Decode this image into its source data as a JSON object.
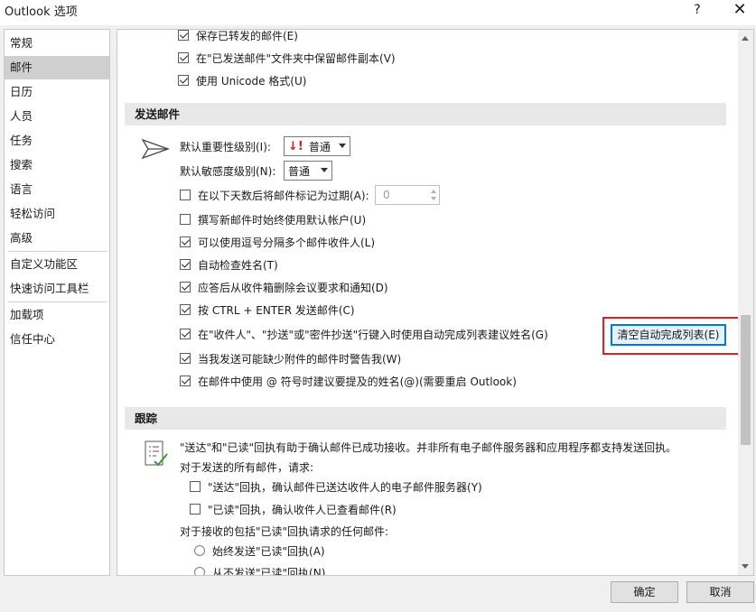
{
  "window": {
    "title": "Outlook 选项",
    "help": "?",
    "close": "✕"
  },
  "sidebar": {
    "items": [
      {
        "label": "常规"
      },
      {
        "label": "邮件"
      },
      {
        "label": "日历"
      },
      {
        "label": "人员"
      },
      {
        "label": "任务"
      },
      {
        "label": "搜索"
      },
      {
        "label": "语言"
      },
      {
        "label": "轻松访问"
      },
      {
        "label": "高级"
      },
      {
        "label": "自定义功能区"
      },
      {
        "label": "快速访问工具栏"
      },
      {
        "label": "加载项"
      },
      {
        "label": "信任中心"
      }
    ],
    "selected": "邮件"
  },
  "save": {
    "forwarded": "保存已转发的邮件(E)",
    "sent_copy": "在\"已发送邮件\"文件夹中保留邮件副本(V)",
    "unicode": "使用 Unicode 格式(U)"
  },
  "send": {
    "header": "发送邮件",
    "importance_label": "默认重要性级别(I):",
    "importance_value": "普通",
    "sensitivity_label": "默认敏感度级别(N):",
    "sensitivity_value": "普通",
    "expire": "在以下天数后将邮件标记为过期(A):",
    "expire_days": "0",
    "default_account": "撰写新邮件时始终使用默认帐户(U)",
    "comma_sep": "可以使用逗号分隔多个邮件收件人(L)",
    "check_names": "自动检查姓名(T)",
    "delete_meeting": "应答后从收件箱删除会议要求和通知(D)",
    "ctrl_enter": "按 CTRL + ENTER 发送邮件(C)",
    "autocomplete": "在\"收件人\"、\"抄送\"或\"密件抄送\"行键入时使用自动完成列表建议姓名(G)",
    "clear_button": "清空自动完成列表(E)",
    "attachment_warn": "当我发送可能缺少附件的邮件时警告我(W)",
    "mention": "在邮件中使用 @ 符号时建议要提及的姓名(@)(需要重启 Outlook)"
  },
  "tracking": {
    "header": "跟踪",
    "desc": "\"送达\"和\"已读\"回执有助于确认邮件已成功接收。并非所有电子邮件服务器和应用程序都支持发送回执。",
    "for_sent": "对于发送的所有邮件，请求:",
    "delivery": "\"送达\"回执，确认邮件已送达收件人的电子邮件服务器(Y)",
    "read": "\"已读\"回执，确认收件人已查看邮件(R)",
    "for_received": "对于接收的包括\"已读\"回执请求的任何邮件:",
    "always": "始终发送\"已读\"回执(A)",
    "never": "从不发送\"已读\"回执(N)"
  },
  "footer": {
    "ok": "确定",
    "cancel": "取消"
  },
  "colors": {
    "highlight_outline": "#e02020",
    "button_focus": "#0078d4",
    "importance_icon": "#d02020"
  }
}
